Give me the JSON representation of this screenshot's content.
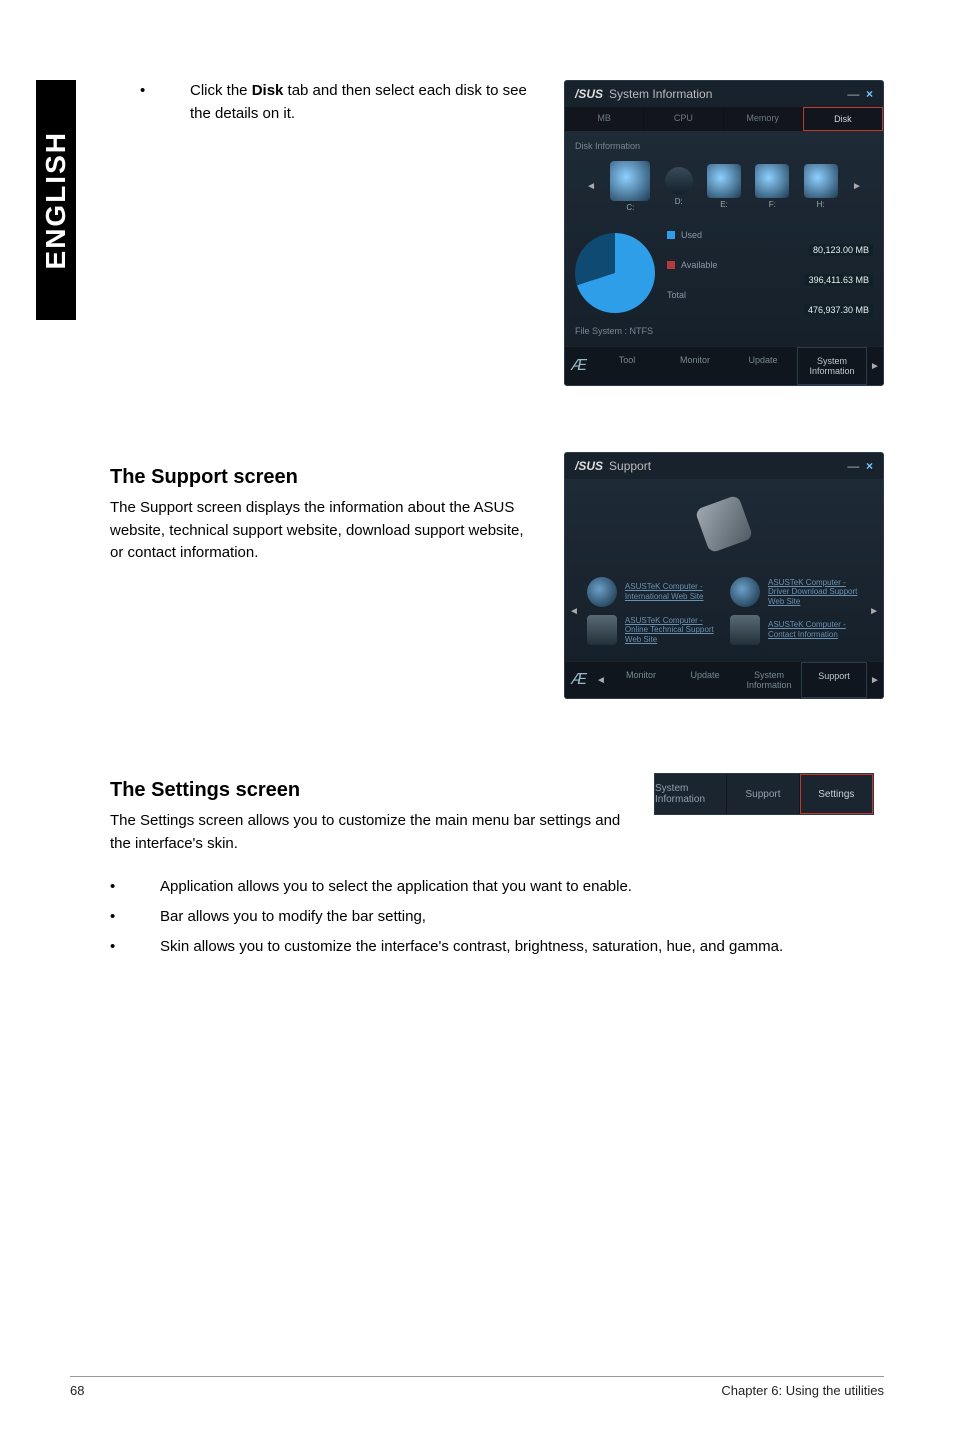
{
  "sideTab": "ENGLISH",
  "block1": {
    "bullet": "•",
    "text_a": "Click the ",
    "text_bold": "Disk",
    "text_b": " tab and then select each disk to see the details on it."
  },
  "mock1": {
    "brand": "/SUS",
    "title": "System Information",
    "min": "—",
    "close": "×",
    "tabs": {
      "mb": "MB",
      "cpu": "CPU",
      "mem": "Memory",
      "disk": "Disk"
    },
    "diskInfoLabel": "Disk Information",
    "driveLabels": {
      "a": "C:",
      "b": "D:",
      "c": "E:",
      "d": "F:",
      "e": "H:"
    },
    "legend": {
      "used": "Used",
      "usedVal": "80,123.00 MB",
      "avail": "Available",
      "availVal": "396,411.63 MB",
      "total": "Total",
      "totalVal": "476,937.30 MB"
    },
    "fs": "File System : NTFS",
    "footer": {
      "tool": "Tool",
      "monitor": "Monitor",
      "update": "Update",
      "sysinfo": "System Information"
    }
  },
  "support": {
    "heading": "The Support screen",
    "para": "The Support screen displays the information about the ASUS website, technical support website, download support website, or contact information."
  },
  "mock2": {
    "brand": "/SUS",
    "title": "Support",
    "min": "—",
    "close": "×",
    "items": {
      "a": "ASUSTeK Computer - International Web Site",
      "b": "ASUSTeK Computer - Driver Download Support Web Site",
      "c": "ASUSTeK Computer - Online Technical Support Web Site",
      "d": "ASUSTeK Computer - Contact Information"
    },
    "footer": {
      "monitor": "Monitor",
      "update": "Update",
      "sysinfo": "System Information",
      "support": "Support"
    }
  },
  "settings": {
    "heading": "The Settings screen",
    "para": "The Settings screen allows you to customize the main menu bar settings and the interface's skin."
  },
  "mock3": {
    "tabs": {
      "sysinfo": "System Information",
      "support": "Support",
      "settings": "Settings"
    }
  },
  "list": {
    "b": "•",
    "i1": "Application allows you to select the application that you want to enable.",
    "i2": "Bar allows you to modify the bar setting,",
    "i3": "Skin allows you to customize the interface's contrast, brightness, saturation, hue, and gamma."
  },
  "footer": {
    "page": "68",
    "chapter": "Chapter 6: Using the utilities"
  }
}
